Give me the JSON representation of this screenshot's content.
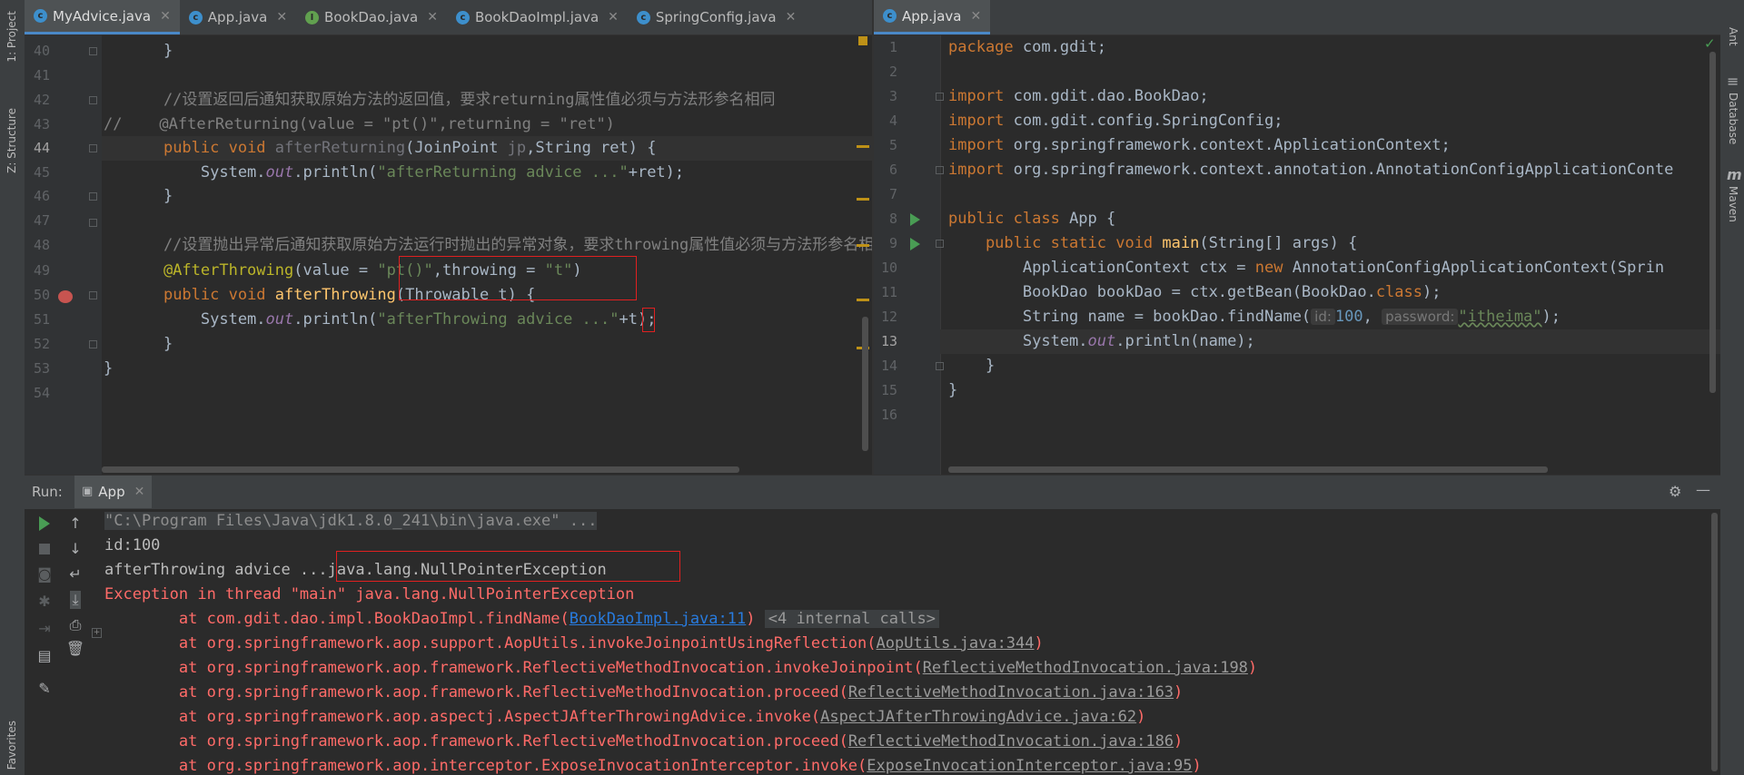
{
  "left_strip": {
    "project_label": "1: Project",
    "structure_label": "Z: Structure",
    "favorites_label": "Favorites"
  },
  "right_strip": {
    "ant_label": "Ant",
    "database_label": "Database",
    "maven_label": "Maven"
  },
  "left_tabs": [
    {
      "label": "MyAdvice.java",
      "icon": "c"
    },
    {
      "label": "App.java",
      "icon": "c"
    },
    {
      "label": "BookDao.java",
      "icon": "i"
    },
    {
      "label": "BookDaoImpl.java",
      "icon": "c"
    },
    {
      "label": "SpringConfig.java",
      "icon": "c"
    }
  ],
  "right_tabs": [
    {
      "label": "App.java",
      "icon": "c"
    }
  ],
  "left_editor": {
    "line_numbers": [
      "40",
      "41",
      "42",
      "43",
      "44",
      "45",
      "46",
      "47",
      "48",
      "49",
      "50",
      "51",
      "52",
      "53",
      "54"
    ],
    "current_line": "44",
    "lines": {
      "l40": "    }",
      "l42": "    //设置返回后通知获取原始方法的返回值，要求returning属性值必须与方法形参名相同",
      "l43": "//    @AfterReturning(value = \"pt()\",returning = \"ret\")",
      "l44a": "    ",
      "l44kw": "public void ",
      "l44fn": "afterReturning",
      "l44b": "(JoinPoint ",
      "l44c": "jp",
      "l44d": ",String ret) {",
      "l45a": "        System.",
      "l45b": "out",
      "l45c": ".println(",
      "l45d": "\"afterReturning advice ...\"",
      "l45e": "+ret);",
      "l46": "    }",
      "l48": "    //设置抛出异常后通知获取原始方法运行时抛出的异常对象，要求throwing属性值必须与方法形参名相同",
      "l49a": "    @AfterThrowing",
      "l49b": "(value = ",
      "l49c": "\"pt()\"",
      "l49d": ",throwing = ",
      "l49e": "\"t\"",
      "l49f": ")",
      "l50a": "    ",
      "l50kw": "public void ",
      "l50fn": "afterThrowing",
      "l50b": "(Throwable t) {",
      "l51a": "        System.",
      "l51b": "out",
      "l51c": ".println(",
      "l51d": "\"afterThrowing advice ...\"",
      "l51e": "+t);",
      "l52": "    }",
      "l53": "}"
    }
  },
  "right_editor": {
    "line_numbers": [
      "1",
      "2",
      "3",
      "4",
      "5",
      "6",
      "7",
      "8",
      "9",
      "10",
      "11",
      "12",
      "13",
      "14",
      "15",
      "16"
    ],
    "current_line": "13",
    "lines": {
      "l1kw": "package ",
      "l1b": "com.gdit;",
      "l3kw": "import ",
      "l3b": "com.gdit.dao.BookDao;",
      "l4kw": "import ",
      "l4b": "com.gdit.config.SpringConfig;",
      "l5kw": "import ",
      "l5b": "org.springframework.context.ApplicationContext;",
      "l6kw": "import ",
      "l6b": "org.springframework.context.annotation.AnnotationConfigApplicationConte",
      "l8kw": "public class ",
      "l8b": "App {",
      "l9kw": "    public static void ",
      "l9fn": "main",
      "l9b": "(String[] args) {",
      "l10a": "        ApplicationContext ctx = ",
      "l10kw": "new ",
      "l10b": "AnnotationConfigApplicationContext(Sprin",
      "l11a": "        BookDao bookDao = ctx.getBean(BookDao.",
      "l11kw": "class",
      "l11b": ");",
      "l12a": "        String name = bookDao.findName(",
      "l12h1": "id:",
      "l12n": "100",
      "l12c": ", ",
      "l12h2": "password:",
      "l12s": "\"itheima\"",
      "l12d": ");",
      "l13a": "        System.",
      "l13b": "out",
      "l13c": ".println(name);",
      "l14": "    }",
      "l15": "}"
    }
  },
  "run_bar": {
    "run_label": "Run:",
    "tab_label": "App"
  },
  "console": {
    "cmd": "\"C:\\Program Files\\Java\\jdk1.8.0_241\\bin\\java.exe\" ...",
    "out1": "id:100",
    "out2": "afterThrowing advice ...java.lang.NullPointerException",
    "err_head": "Exception in thread \"main\" java.lang.NullPointerException",
    "frames": [
      {
        "pre": "\tat com.gdit.dao.impl.BookDaoImpl.findName(",
        "link": "BookDaoImpl.java:11",
        "post": ")",
        "extra": "<4 internal calls>",
        "primary": true
      },
      {
        "pre": "\tat org.springframework.aop.support.AopUtils.invokeJoinpointUsingReflection(",
        "link": "AopUtils.java:344",
        "post": ")"
      },
      {
        "pre": "\tat org.springframework.aop.framework.ReflectiveMethodInvocation.invokeJoinpoint(",
        "link": "ReflectiveMethodInvocation.java:198",
        "post": ")"
      },
      {
        "pre": "\tat org.springframework.aop.framework.ReflectiveMethodInvocation.proceed(",
        "link": "ReflectiveMethodInvocation.java:163",
        "post": ")"
      },
      {
        "pre": "\tat org.springframework.aop.aspectj.AspectJAfterThrowingAdvice.invoke(",
        "link": "AspectJAfterThrowingAdvice.java:62",
        "post": ")"
      },
      {
        "pre": "\tat org.springframework.aop.framework.ReflectiveMethodInvocation.proceed(",
        "link": "ReflectiveMethodInvocation.java:186",
        "post": ")"
      },
      {
        "pre": "\tat org.springframework.aop.interceptor.ExposeInvocationInterceptor.invoke(",
        "link": "ExposeInvocationInterceptor.java:95",
        "post": ")"
      }
    ]
  }
}
